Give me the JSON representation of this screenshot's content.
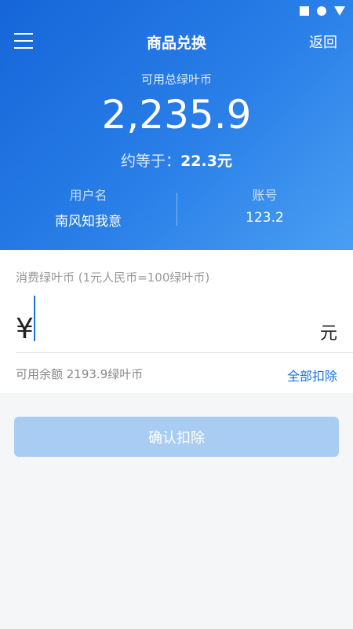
{
  "status_bar": {
    "icons": [
      "square-icon",
      "circle-icon",
      "triangle-icon"
    ],
    "color": "#ffffff"
  },
  "header": {
    "title": "商品兑换",
    "back_label": "返回"
  },
  "balance": {
    "label": "可用总绿叶币",
    "value": "2,235.9",
    "approx_label": "约等于：",
    "approx_value": "22.3元"
  },
  "account": {
    "username_label": "用户名",
    "username": "南风知我意",
    "account_label": "账号",
    "account_no": "123.2"
  },
  "exchange": {
    "label": "消费绿叶币 (1元人民币=100绿叶币)",
    "currency_symbol": "¥",
    "amount_value": "",
    "unit": "元",
    "available_text": "可用余额 2193.9绿叶币",
    "deduct_all_label": "全部扣除"
  },
  "confirm": {
    "label": "确认扣除",
    "enabled": false
  },
  "colors": {
    "primary": "#1b73e0",
    "gradient_start": "#1565d8",
    "gradient_end": "#4a9ff2",
    "button_disabled": "#a9cdf2"
  }
}
